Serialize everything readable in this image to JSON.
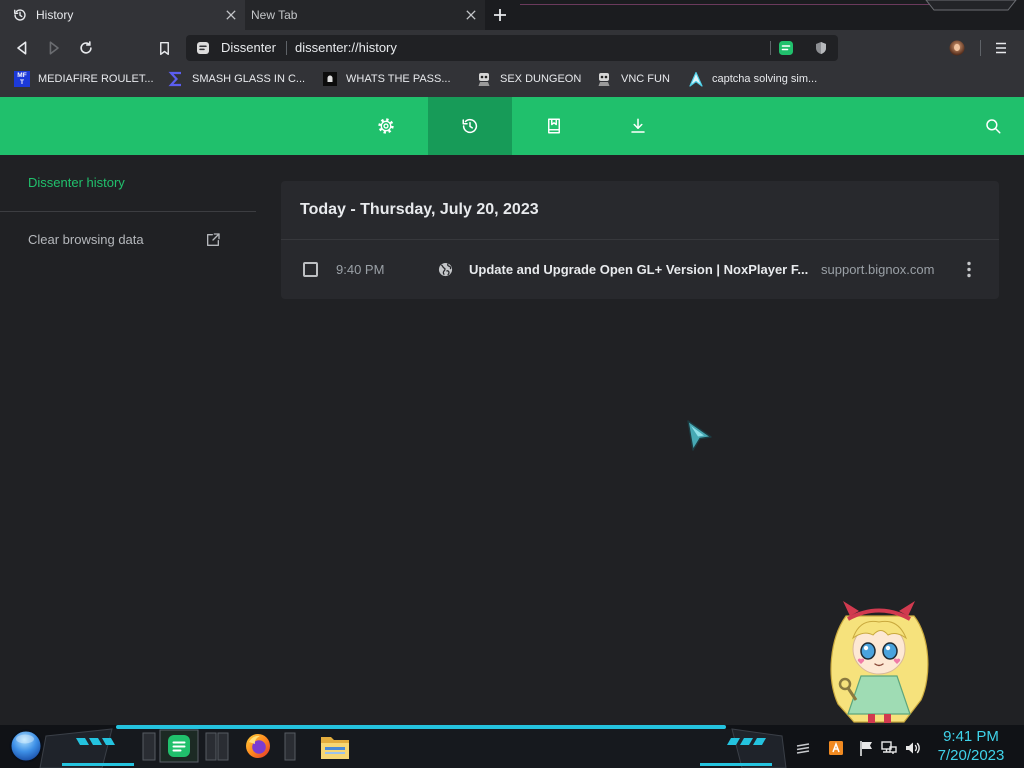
{
  "browser": {
    "tabs": [
      {
        "title": "History",
        "icon": "history-icon",
        "active": true
      },
      {
        "title": "New Tab",
        "active": false
      }
    ],
    "toolbar": {
      "site_name": "Dissenter",
      "url": "dissenter://history",
      "forward_disabled": true,
      "icons": [
        "back-arrow-icon",
        "forward-arrow-icon",
        "reload-icon",
        "bookmark-icon",
        "dissenter-comment-icon",
        "shield-icon",
        "profile-avatar",
        "hamburger-menu-icon"
      ]
    },
    "bookmarks": [
      {
        "label": "MEDIAFIRE ROULET...",
        "icon": "mediafire-icon",
        "icon_text": [
          "MF",
          "T"
        ]
      },
      {
        "label": "SMASH GLASS IN C...",
        "icon": "sigma-icon"
      },
      {
        "label": "WHATS THE PASS...",
        "icon": "dark-site-icon"
      },
      {
        "label": "SEX DUNGEON",
        "icon": "robot-icon"
      },
      {
        "label": "VNC FUN",
        "icon": "robot-icon"
      },
      {
        "label": "captcha solving sim...",
        "icon": "teal-a-icon"
      }
    ]
  },
  "app_nav": {
    "items": [
      {
        "icon": "gear-icon",
        "active": false
      },
      {
        "icon": "history-icon",
        "active": true
      },
      {
        "icon": "bookmark-book-icon",
        "active": false
      },
      {
        "icon": "download-icon",
        "active": false
      }
    ],
    "search_icon": "search-icon"
  },
  "sidebar": {
    "title": "Dissenter history",
    "clear_label": "Clear browsing data",
    "clear_icon": "external-link-icon"
  },
  "history": {
    "heading": "Today - Thursday, July 20, 2023",
    "entries": [
      {
        "checked": false,
        "time": "9:40 PM",
        "favicon": "globe-icon",
        "title": "Update and Upgrade Open GL+ Version | NoxPlayer F...",
        "domain": "support.bignox.com",
        "menu_icon": "more-vertical-icon"
      }
    ]
  },
  "taskbar": {
    "start_icon": "start-orb-icon",
    "apps": [
      {
        "icon": "dissenter-app-icon",
        "active": true
      },
      {
        "icon": "firefox-icon",
        "active": false
      },
      {
        "icon": "file-explorer-icon",
        "active": false
      }
    ],
    "tray_icons": [
      "hidden-icons-icon",
      "orange-app-icon",
      "flag-icon",
      "network-icon",
      "volume-icon"
    ],
    "clock": {
      "time": "9:41 PM",
      "date": "7/20/2023"
    }
  },
  "colors": {
    "accent_green": "#20c06c",
    "nav_active_green": "#179b58",
    "page_background": "#202124",
    "card_background": "#28292d",
    "clock_cyan": "#3fd3ea",
    "taskbar_cyan": "#24c3df"
  }
}
